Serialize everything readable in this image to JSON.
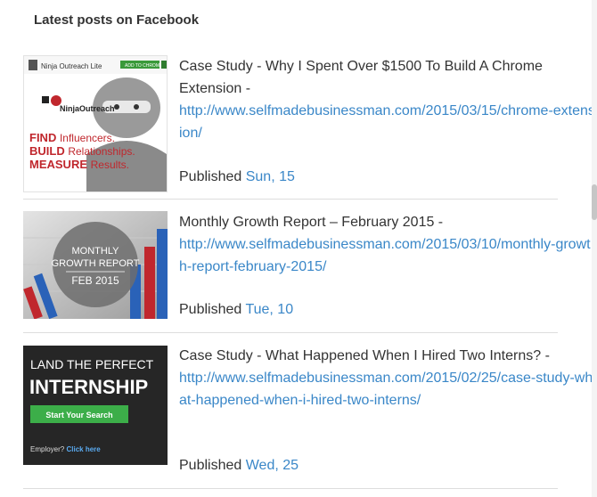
{
  "heading": "Latest posts on Facebook",
  "posts": [
    {
      "title": "Case Study - Why I Spent Over $1500 To Build A Chrome Extension -",
      "link": "http://www.selfmadebusinessman.com/2015/03/15/chrome-extension/",
      "published_label": "Published",
      "date": "Sun, 15",
      "thumb": {
        "brand_small": "Ninja Outreach Lite",
        "cta_small": "ADD TO CHROME",
        "brand": "NinjaOutreach",
        "line1_a": "FIND",
        "line1_b": "Influencers.",
        "line2_a": "BUILD",
        "line2_b": "Relationships.",
        "line3_a": "MEASURE",
        "line3_b": "Results."
      }
    },
    {
      "title": "Monthly Growth Report – February 2015 -",
      "link": "http://www.selfmadebusinessman.com/2015/03/10/monthly-growth-report-february-2015/",
      "published_label": "Published",
      "date": "Tue, 10",
      "thumb": {
        "line1": "MONTHLY",
        "line2": "GROWTH REPORT",
        "line3": "FEB 2015"
      }
    },
    {
      "title": "Case Study - What Happened When I Hired Two Interns? -",
      "link": "http://www.selfmadebusinessman.com/2015/02/25/case-study-what-happened-when-i-hired-two-interns/",
      "published_label": "Published",
      "date": "Wed, 25",
      "thumb": {
        "line1": "LAND THE PERFECT",
        "line2": "INTERNSHIP",
        "button": "Start Your Search",
        "employer": "Employer?",
        "click": "Click here"
      }
    }
  ],
  "colors": {
    "link": "#3a87c8",
    "text": "#333333",
    "divider": "#dddddd"
  }
}
